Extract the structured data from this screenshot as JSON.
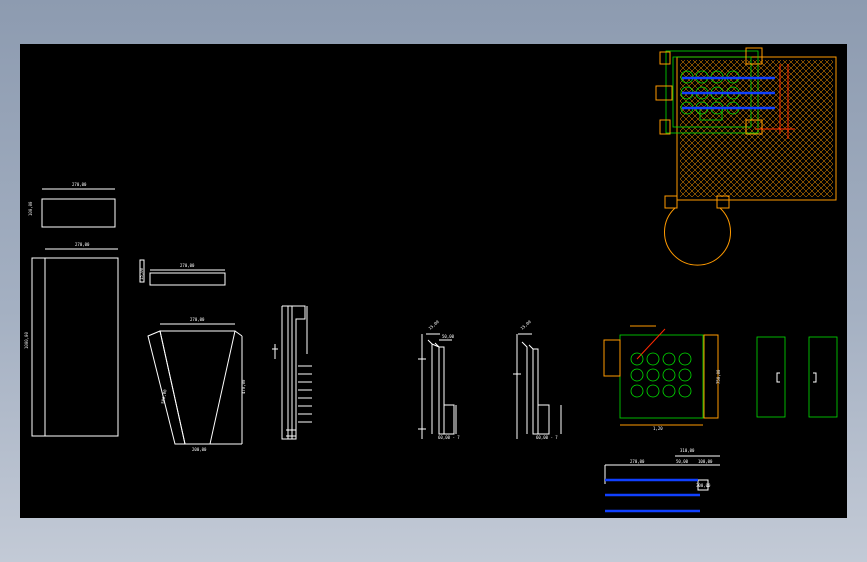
{
  "drawing": {
    "dim_top_block": "270,00",
    "dim_top_block_side": "100,00",
    "dim_tall_block": "270,00",
    "dim_tall_block_side": "1000,00",
    "dim_flat_bar": "270,00",
    "dim_flat_bar_side": "15,00",
    "dim_trapezoid_top": "270,00",
    "dim_trapezoid_bottom": "200,00",
    "dim_trapezoid_left": "500,00",
    "dim_trapezoid_right": "470,00",
    "dim_side_a": "50,00",
    "dim_side_b": "60,00 - 7",
    "dim_side_c": "15,00",
    "dim_plate_width": "1,20",
    "dim_plate_height": "750,00",
    "dim_bottom_a": "270,00",
    "dim_bottom_b": "50,00",
    "dim_bottom_c": "310,00",
    "dim_bottom_d": "100,00",
    "dim_bottom_e": "300,00",
    "colors": {
      "line": "#ffffff",
      "green": "#00e000",
      "orange": "#ff9a00",
      "blue": "#1040ff",
      "red": "#ff2a00"
    }
  }
}
